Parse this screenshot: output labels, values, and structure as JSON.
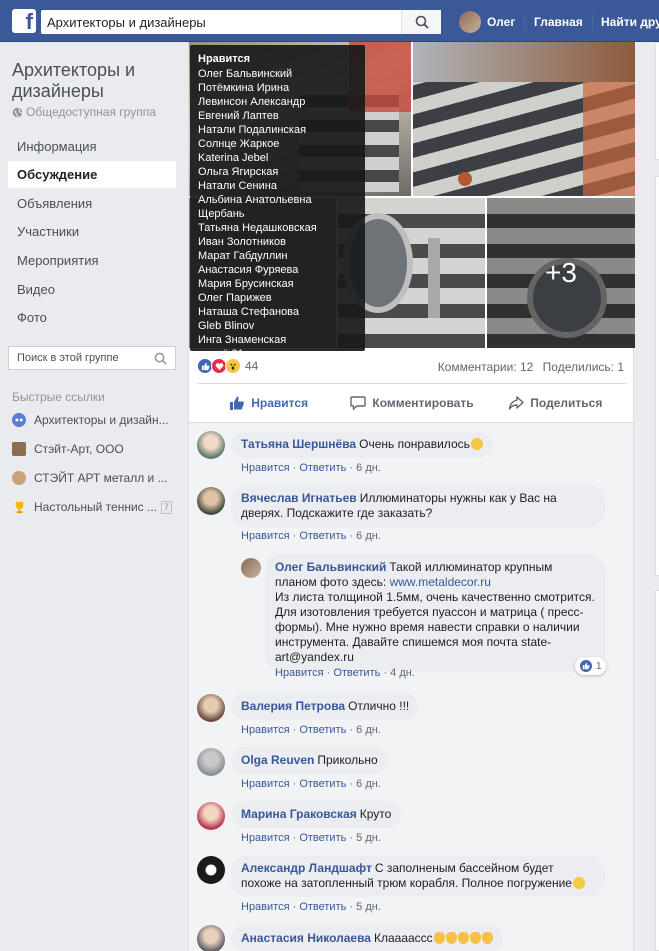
{
  "topbar": {
    "search_value": "Архитекторы и дизайнеры",
    "user_name": "Олег",
    "home": "Главная",
    "find_friends": "Найти дру"
  },
  "sidebar": {
    "group_title": "Архитекторы и дизайнеры",
    "group_type": "Общедоступная группа",
    "nav": [
      "Информация",
      "Обсуждение",
      "Объявления",
      "Участники",
      "Мероприятия",
      "Видео",
      "Фото"
    ],
    "search_placeholder": "Поиск в этой группе",
    "quick_links_title": "Быстрые ссылки",
    "quick_links": [
      "Архитекторы и дизайн...",
      "Стэйт-Арт, ООО",
      "СТЭЙТ АРТ металл и ...",
      "Настольный теннис ..."
    ],
    "quick_badge": "7"
  },
  "photos": {
    "more": "+3"
  },
  "likes_tooltip": {
    "title": "Нравится",
    "names": [
      "Олег Бальвинский",
      "Потёмкина Ирина",
      "Левинсон Александр",
      "Евгений Лаптев",
      "Натали Подалинская",
      "Солнце Жаркое",
      "Katerina Jebel",
      "Ольга Ягирская",
      "Натали Сенина",
      "Альбина Анатольевна Щербань",
      "Татьяна Недашковская",
      "Иван Золотников",
      "Марат Габдуллин",
      "Анастасия Фуряева",
      "Мария Брусинская",
      "Олег Парижев",
      "Наташа Стефанова",
      "Gleb Blinov",
      "Инга Знаменская"
    ],
    "and_more": "и ещё 21..."
  },
  "post": {
    "reaction_count": "44",
    "comments_label": "Комментарии: 12",
    "shares_label": "Поделились: 1",
    "like_button": "Нравится",
    "comment_button": "Комментировать",
    "share_button": "Поделиться"
  },
  "comment_meta": {
    "like": "Нравится",
    "reply": "Ответить",
    "sep": " · "
  },
  "comments": [
    {
      "author": "Татьяна Шершнёва",
      "text": "Очень понравилось",
      "time": "6 дн."
    },
    {
      "author": "Вячеслав Игнатьев",
      "text": "Иллюминаторы нужны как у Вас на дверях. Подскажите где заказать?",
      "time": "6 дн."
    },
    {
      "author": "Олег Бальвинский",
      "text1": "Такой иллюминатор крупным планом фото здесь:",
      "link": "www.metaldecor.ru",
      "text2": "Из листа толщиной 1.5мм, очень качественно смотрится. Для изотовления требуется пуассон и матрица ( пресс-формы). Мне нужно время навести справки о наличии инструмента. Давайте спишемся моя почта state-art@yandex.ru",
      "time": "4 дн.",
      "likes": "1"
    },
    {
      "author": "Валерия Петрова",
      "text": "Отлично !!!",
      "time": "6 дн."
    },
    {
      "author": "Olga Reuven",
      "text": "Прикольно",
      "time": "6 дн."
    },
    {
      "author": "Марина Граковская",
      "text": "Круто",
      "time": "5 дн."
    },
    {
      "author": "Александр Ландшафт",
      "text": "С заполненым бассейном будет похоже на затопленный трюм корабля. Полное погружение",
      "time": "5 дн."
    },
    {
      "author": "Анастасия Николаева",
      "text": "Клаааассс"
    }
  ],
  "colors": {
    "brand": "#3b5998",
    "link": "#385898",
    "like_blue": "#4267b2"
  }
}
